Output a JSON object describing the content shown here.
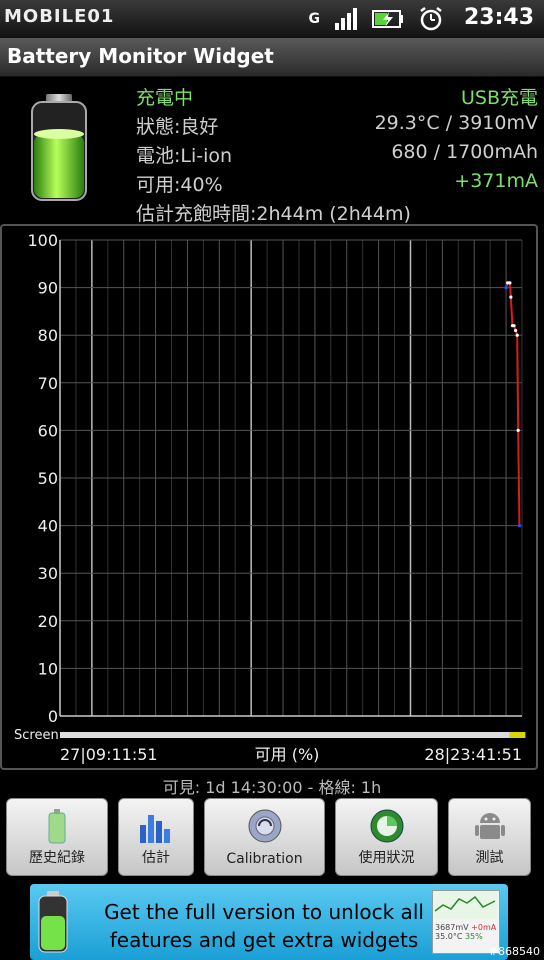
{
  "status_bar": {
    "brand": "MOBILE01",
    "time": "23:43",
    "net": "G"
  },
  "title": "Battery Monitor Widget",
  "info": {
    "charging": "充電中",
    "source": "USB充電",
    "status": "狀態:良好",
    "temp_voltage": "29.3°C / 3910mV",
    "battery": "電池:Li-ion",
    "capacity": "680 / 1700mAh",
    "available": "可用:40%",
    "current": "+371mA",
    "estimate": "估計充飽時間:2h44m (2h44m)"
  },
  "chart_data": {
    "type": "line",
    "title": "",
    "xlabel": "可用 (%)",
    "ylabel": "",
    "ylim": [
      0,
      100
    ],
    "y_ticks": [
      0,
      10,
      20,
      30,
      40,
      50,
      60,
      70,
      80,
      90,
      100
    ],
    "x_start": "27|09:11:51",
    "x_end": "28|23:41:51",
    "screen_label": "Screen",
    "grid": true,
    "x_hours": [
      0,
      1,
      2,
      3,
      4,
      5,
      6,
      7,
      8,
      9,
      10,
      11,
      12,
      13,
      14,
      14.5
    ],
    "series": [
      {
        "values": [
          [
            14.0,
            90
          ],
          [
            14.05,
            91
          ],
          [
            14.12,
            91
          ],
          [
            14.15,
            88
          ],
          [
            14.2,
            82
          ],
          [
            14.25,
            82
          ],
          [
            14.3,
            81
          ],
          [
            14.35,
            80
          ],
          [
            14.38,
            60
          ],
          [
            14.42,
            40
          ]
        ]
      }
    ],
    "colors": {
      "grid": "#555555",
      "line": "#e01919",
      "marker_start": "#2850ff",
      "marker_end": "#2850ff"
    }
  },
  "visible_info": "可見: 1d 14:30:00 - 格線: 1h",
  "buttons": [
    {
      "label": "歷史紀錄",
      "icon": "history-icon"
    },
    {
      "label": "估計",
      "icon": "estimate-icon"
    },
    {
      "label": "Calibration",
      "icon": "calibration-icon"
    },
    {
      "label": "使用狀況",
      "icon": "usage-icon"
    },
    {
      "label": "測試",
      "icon": "android-test-icon"
    }
  ],
  "ad": {
    "text": "Get the full version to unlock all features and get extra widgets",
    "mini_values": [
      "3687mV",
      "+0mA",
      "35.0°C",
      "35%"
    ]
  },
  "watermark": "#868540"
}
